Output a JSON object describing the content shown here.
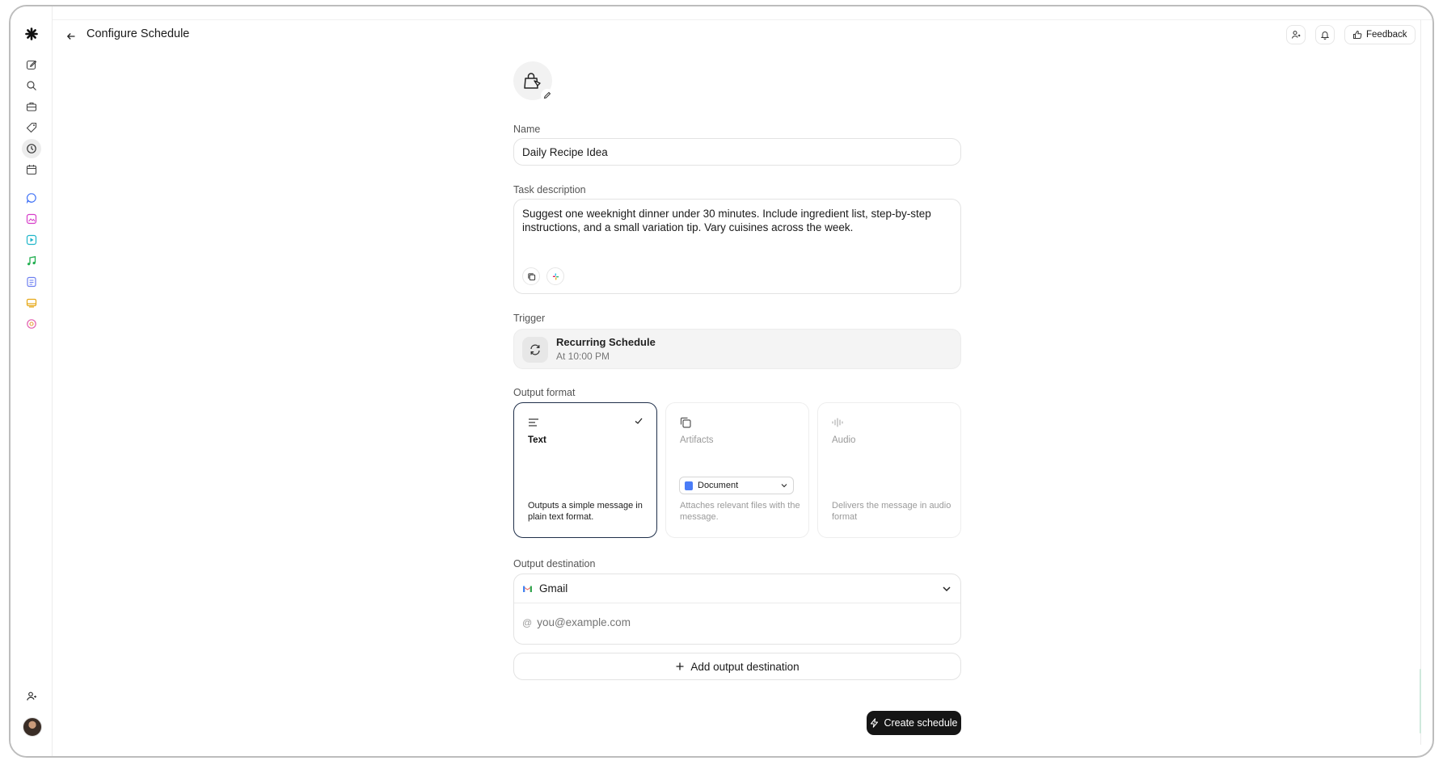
{
  "header": {
    "title": "Configure Schedule",
    "feedback_label": "Feedback"
  },
  "sidebar": {
    "items": [
      {
        "name": "new-chat",
        "icon": "pencil-square-icon"
      },
      {
        "name": "search",
        "icon": "search-icon"
      },
      {
        "name": "briefcase",
        "icon": "briefcase-icon"
      },
      {
        "name": "tags",
        "icon": "tag-icon"
      },
      {
        "name": "schedules",
        "icon": "clock-icon",
        "active": true
      },
      {
        "name": "calendar",
        "icon": "calendar-icon"
      },
      {
        "name": "chat",
        "icon": "chat-bubble-icon",
        "color": "#3b6ef6"
      },
      {
        "name": "image",
        "icon": "image-icon",
        "color": "#d63cc8"
      },
      {
        "name": "video",
        "icon": "video-icon",
        "color": "#1fb5c9"
      },
      {
        "name": "music",
        "icon": "music-note-icon",
        "color": "#1fae4e"
      },
      {
        "name": "docs",
        "icon": "document-icon",
        "color": "#6d7ff0"
      },
      {
        "name": "slides",
        "icon": "slides-icon",
        "color": "#e6a817"
      },
      {
        "name": "more",
        "icon": "sparkle-circle-icon",
        "color": "#e25fb0"
      }
    ]
  },
  "form": {
    "name_label": "Name",
    "name_value": "Daily Recipe Idea",
    "description_label": "Task description",
    "description_value": "Suggest one weeknight dinner under 30 minutes. Include ingredient list, step-by-step instructions, and a small variation tip. Vary cuisines across the week.",
    "trigger_label": "Trigger",
    "trigger_title": "Recurring Schedule",
    "trigger_subtitle": "At 10:00 PM",
    "output_format_label": "Output format",
    "formats": [
      {
        "title": "Text",
        "description": "Outputs a simple message in plain text format.",
        "selected": true
      },
      {
        "title": "Artifacts",
        "description": "Attaches relevant files with the message.",
        "selected": false,
        "select_value": "Document"
      },
      {
        "title": "Audio",
        "description": "Delivers the message in audio format",
        "selected": false
      }
    ],
    "output_destination_label": "Output destination",
    "destination_value": "Gmail",
    "email_placeholder": "you@example.com",
    "add_destination_label": "Add output destination",
    "create_label": "Create schedule"
  },
  "colors": {
    "selected_border": "#1f2f4a",
    "primary_button": "#151515",
    "gmail_red": "#ea4335"
  }
}
